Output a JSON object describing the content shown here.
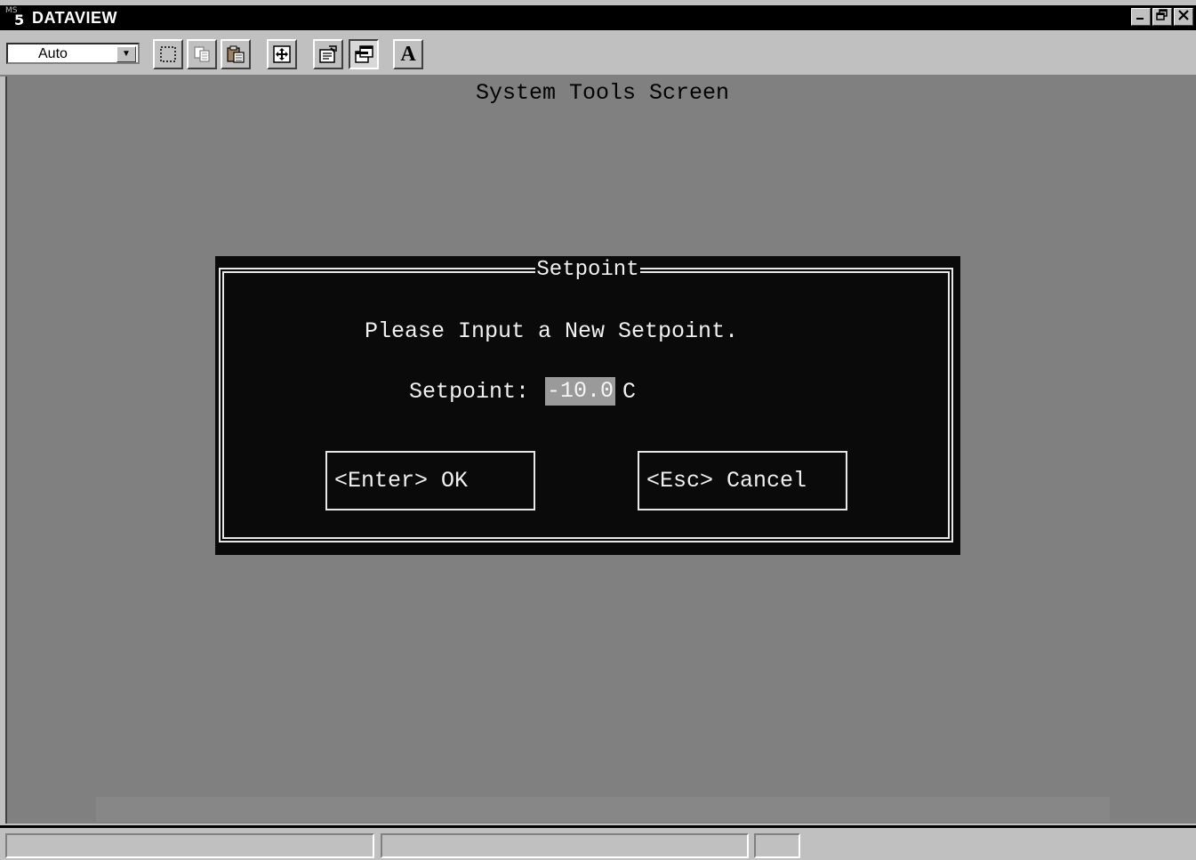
{
  "window": {
    "icon_small": "MS",
    "icon_number": "5",
    "title": "DATAVIEW",
    "controls": [
      "minimize",
      "restore",
      "close"
    ]
  },
  "toolbar": {
    "font_size_value": "Auto",
    "buttons": [
      {
        "name": "select-icon"
      },
      {
        "name": "copy-icon"
      },
      {
        "name": "paste-icon"
      },
      {
        "name": "fullscreen-icon"
      },
      {
        "name": "properties-icon"
      },
      {
        "name": "background-icon"
      },
      {
        "name": "font-icon",
        "label": "A"
      }
    ]
  },
  "screen": {
    "title": "System Tools Screen"
  },
  "dialog": {
    "title": "Setpoint",
    "prompt": "Please Input a New Setpoint.",
    "setpoint_label": "Setpoint:",
    "setpoint_value": "-10.0",
    "unit": "C",
    "ok_label": "<Enter> OK",
    "cancel_label": "<Esc> Cancel"
  },
  "colors": {
    "screen_bg": "#808080",
    "dialog_bg": "#0a0a0a",
    "dialog_text": "#f0f0f0",
    "input_highlight": "#9a9a9a"
  }
}
